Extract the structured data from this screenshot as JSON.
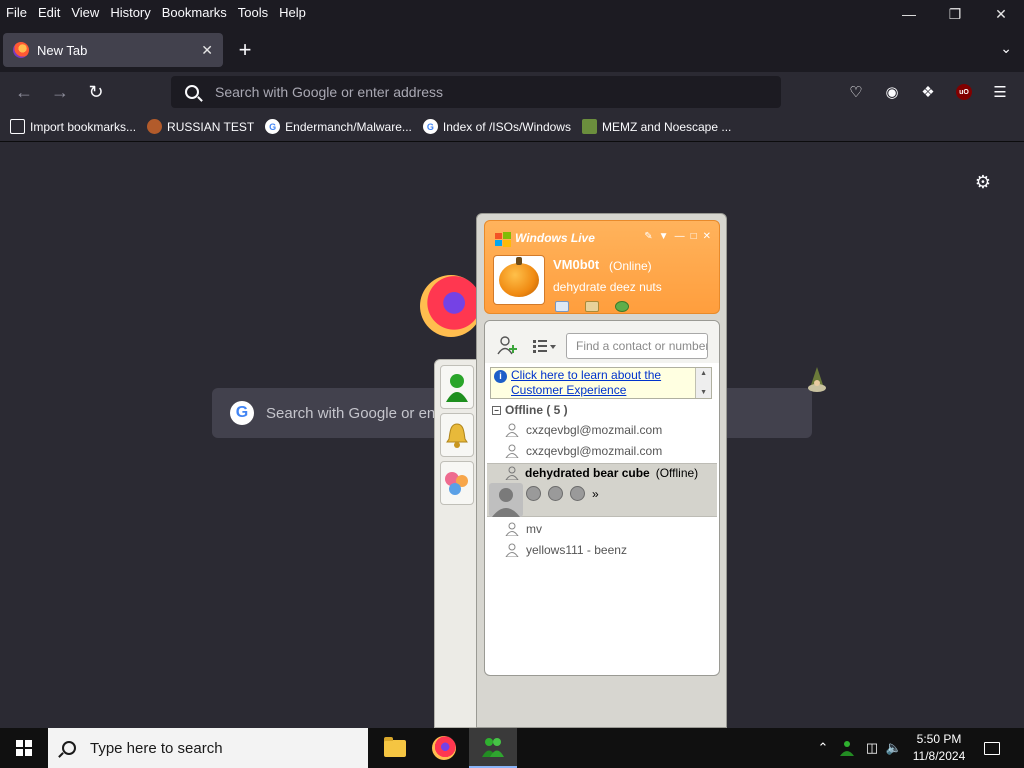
{
  "menu": [
    "File",
    "Edit",
    "View",
    "History",
    "Bookmarks",
    "Tools",
    "Help"
  ],
  "tab": {
    "title": "New Tab"
  },
  "urlbar": {
    "placeholder": "Search with Google or enter address"
  },
  "bookmarks": [
    {
      "label": "Import bookmarks...",
      "icon": "import-icon"
    },
    {
      "label": "RUSSIAN TEST",
      "icon": "russian-test-favicon"
    },
    {
      "label": "Endermanch/Malware...",
      "icon": "google-icon"
    },
    {
      "label": "Index of /ISOs/Windows",
      "icon": "google-icon"
    },
    {
      "label": "MEMZ and Noescape ...",
      "icon": "memz-favicon"
    }
  ],
  "newtab": {
    "search_placeholder": "Search with Google or ent"
  },
  "messenger": {
    "brand": "Windows Live",
    "user": {
      "name": "VM0b0t",
      "status": "(Online)",
      "personal_message": "dehydrate deez nuts"
    },
    "find_placeholder": "Find a contact or number",
    "banner": {
      "line1": "Click here to learn about the",
      "line2": "Customer Experience"
    },
    "group": {
      "label": "Offline ( 5 )"
    },
    "contacts": [
      "cxzqevbgl@mozmail.com",
      "cxzqevbgl@mozmail.com"
    ],
    "selected": {
      "name": "dehydrated bear cube",
      "status": "(Offline)",
      "more": "»"
    },
    "contacts_after": [
      "mv",
      "yellows111 - beenz"
    ]
  },
  "taskbar": {
    "search_placeholder": "Type here to search",
    "time": "5:50 PM",
    "date": "11/8/2024"
  },
  "colors": {
    "browser_bg": "#2b2a33",
    "chrome_bg": "#1c1b22",
    "messenger_header": "#ffa64a",
    "link": "#0033cc"
  }
}
